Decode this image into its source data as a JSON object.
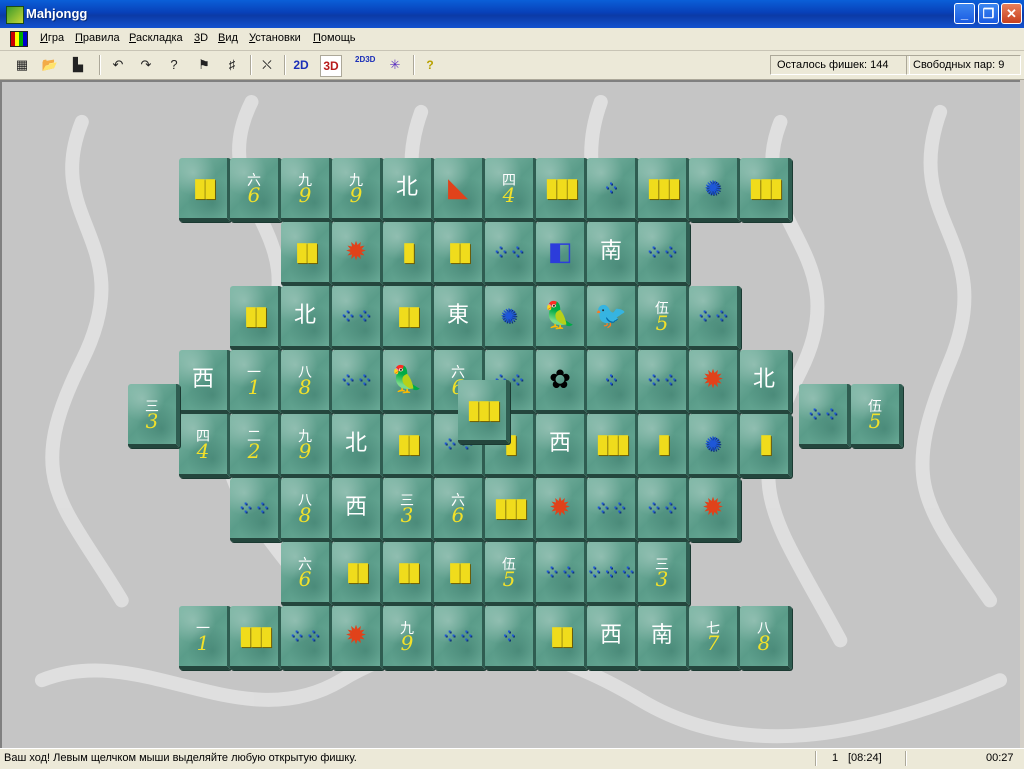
{
  "window": {
    "title": "Mahjongg"
  },
  "menu": [
    "Игра",
    "Правила",
    "Раскладка",
    "3D",
    "Вид",
    "Установки",
    "Помощь"
  ],
  "toolbar": {
    "buttons": [
      {
        "name": "new-game-icon",
        "glyph": "▦"
      },
      {
        "name": "open-game-icon",
        "glyph": "📂"
      },
      {
        "name": "scores-icon",
        "glyph": "▙"
      },
      {
        "name": "undo-icon",
        "glyph": "↶"
      },
      {
        "name": "redo-icon",
        "glyph": "↷"
      },
      {
        "name": "hint-icon",
        "glyph": "?"
      },
      {
        "name": "auto-play-icon",
        "glyph": "⚑"
      },
      {
        "name": "shuffle-icon",
        "glyph": "♯"
      },
      {
        "name": "exit-icon",
        "glyph": "⛌"
      }
    ],
    "view_2d": "2D",
    "view_3d": "3D",
    "toggle_2d3d": "2D3D",
    "help_icon": "?",
    "tiles_left": "Осталось фишек: 144",
    "free_pairs": "Свободных пар: 9"
  },
  "status": {
    "message": "Ваш ход!  Левым щелчком мыши выделяйте любую открытую фишку.",
    "game_number": "1",
    "game_time": "[08:24]",
    "elapsed": "00:27"
  },
  "tiles": [
    {
      "row": 0,
      "col": 0,
      "layer": 0,
      "kind": "bamboo",
      "face": "▮▮"
    },
    {
      "row": 0,
      "col": 1,
      "layer": 0,
      "kind": "char",
      "top": "六",
      "num": "6"
    },
    {
      "row": 0,
      "col": 2,
      "layer": 0,
      "kind": "char",
      "top": "九",
      "num": "9"
    },
    {
      "row": 0,
      "col": 3,
      "layer": 0,
      "kind": "char",
      "top": "九",
      "num": "9"
    },
    {
      "row": 0,
      "col": 4,
      "layer": 0,
      "kind": "wind",
      "face": "北"
    },
    {
      "row": 0,
      "col": 5,
      "layer": 0,
      "kind": "dragon",
      "face": "◣"
    },
    {
      "row": 0,
      "col": 6,
      "layer": 0,
      "kind": "char",
      "top": "四",
      "num": "4"
    },
    {
      "row": 0,
      "col": 7,
      "layer": 0,
      "kind": "bamboo",
      "face": "▮▮▮"
    },
    {
      "row": 0,
      "col": 8,
      "layer": 0,
      "kind": "circle",
      "face": "⁘"
    },
    {
      "row": 0,
      "col": 9,
      "layer": 0,
      "kind": "bamboo",
      "face": "▮▮▮"
    },
    {
      "row": 0,
      "col": 10,
      "layer": 0,
      "kind": "circle",
      "face": "✺"
    },
    {
      "row": 0,
      "col": 11,
      "layer": 0,
      "kind": "bamboo",
      "face": "▮▮▮"
    },
    {
      "row": 1,
      "col": 2,
      "layer": 0,
      "kind": "bamboo",
      "face": "▮▮"
    },
    {
      "row": 1,
      "col": 3,
      "layer": 0,
      "kind": "dragon",
      "face": "✹"
    },
    {
      "row": 1,
      "col": 4,
      "layer": 0,
      "kind": "bamboo",
      "face": "▮"
    },
    {
      "row": 1,
      "col": 5,
      "layer": 0,
      "kind": "bamboo",
      "face": "▮▮"
    },
    {
      "row": 1,
      "col": 6,
      "layer": 0,
      "kind": "circle",
      "face": "⁘⁘"
    },
    {
      "row": 1,
      "col": 7,
      "layer": 0,
      "kind": "season",
      "face": "◧"
    },
    {
      "row": 1,
      "col": 8,
      "layer": 0,
      "kind": "wind",
      "face": "南"
    },
    {
      "row": 1,
      "col": 9,
      "layer": 0,
      "kind": "circle",
      "face": "⁘⁘"
    },
    {
      "row": 2,
      "col": 1,
      "layer": 0,
      "kind": "bamboo",
      "face": "▮▮"
    },
    {
      "row": 2,
      "col": 2,
      "layer": 0,
      "kind": "wind",
      "face": "北"
    },
    {
      "row": 2,
      "col": 3,
      "layer": 0,
      "kind": "circle",
      "face": "⁘⁘"
    },
    {
      "row": 2,
      "col": 4,
      "layer": 0,
      "kind": "bamboo",
      "face": "▮▮"
    },
    {
      "row": 2,
      "col": 5,
      "layer": 0,
      "kind": "wind",
      "face": "東"
    },
    {
      "row": 2,
      "col": 6,
      "layer": 0,
      "kind": "circle",
      "face": "✺"
    },
    {
      "row": 2,
      "col": 7,
      "layer": 0,
      "kind": "flower",
      "face": "🦜"
    },
    {
      "row": 2,
      "col": 8,
      "layer": 0,
      "kind": "flower",
      "face": "🐦"
    },
    {
      "row": 2,
      "col": 9,
      "layer": 0,
      "kind": "char",
      "top": "伍",
      "num": "5"
    },
    {
      "row": 2,
      "col": 10,
      "layer": 0,
      "kind": "circle",
      "face": "⁘⁘"
    },
    {
      "row": 3,
      "col": 0,
      "layer": 0,
      "kind": "wind",
      "face": "西"
    },
    {
      "row": 3,
      "col": 1,
      "layer": 0,
      "kind": "char",
      "top": "一",
      "num": "1"
    },
    {
      "row": 3,
      "col": 2,
      "layer": 0,
      "kind": "char",
      "top": "八",
      "num": "8"
    },
    {
      "row": 3,
      "col": 3,
      "layer": 0,
      "kind": "circle",
      "face": "⁘⁘"
    },
    {
      "row": 3,
      "col": 4,
      "layer": 0,
      "kind": "flower",
      "face": "🦜"
    },
    {
      "row": 3,
      "col": 5,
      "layer": 0,
      "kind": "char",
      "top": "六",
      "num": "6"
    },
    {
      "row": 3,
      "col": 6,
      "layer": 0,
      "kind": "circle",
      "face": "⁘⁘"
    },
    {
      "row": 3,
      "col": 7,
      "layer": 0,
      "kind": "flower",
      "face": "✿"
    },
    {
      "row": 3,
      "col": 8,
      "layer": 0,
      "kind": "circle",
      "face": "⁘"
    },
    {
      "row": 3,
      "col": 9,
      "layer": 0,
      "kind": "circle",
      "face": "⁘⁘"
    },
    {
      "row": 3,
      "col": 10,
      "layer": 0,
      "kind": "dragon",
      "face": "✹"
    },
    {
      "row": 3,
      "col": 11,
      "layer": 0,
      "kind": "wind",
      "face": "北"
    },
    {
      "row": 4,
      "col": 0,
      "layer": 0,
      "kind": "char",
      "top": "四",
      "num": "4"
    },
    {
      "row": 4,
      "col": 1,
      "layer": 0,
      "kind": "char",
      "top": "二",
      "num": "2"
    },
    {
      "row": 4,
      "col": 2,
      "layer": 0,
      "kind": "char",
      "top": "九",
      "num": "9"
    },
    {
      "row": 4,
      "col": 3,
      "layer": 0,
      "kind": "wind",
      "face": "北"
    },
    {
      "row": 4,
      "col": 4,
      "layer": 0,
      "kind": "bamboo",
      "face": "▮▮"
    },
    {
      "row": 4,
      "col": 5,
      "layer": 0,
      "kind": "circle",
      "face": "⁘⁘"
    },
    {
      "row": 4,
      "col": 6,
      "layer": 0,
      "kind": "bamboo",
      "face": "▮"
    },
    {
      "row": 4,
      "col": 7,
      "layer": 0,
      "kind": "wind",
      "face": "西"
    },
    {
      "row": 4,
      "col": 8,
      "layer": 0,
      "kind": "bamboo",
      "face": "▮▮▮"
    },
    {
      "row": 4,
      "col": 9,
      "layer": 0,
      "kind": "bamboo",
      "face": "▮"
    },
    {
      "row": 4,
      "col": 10,
      "layer": 0,
      "kind": "circle",
      "face": "✺"
    },
    {
      "row": 4,
      "col": 11,
      "layer": 0,
      "kind": "bamboo",
      "face": "▮"
    },
    {
      "row": 5,
      "col": 1,
      "layer": 0,
      "kind": "circle",
      "face": "⁘⁘"
    },
    {
      "row": 5,
      "col": 2,
      "layer": 0,
      "kind": "char",
      "top": "八",
      "num": "8"
    },
    {
      "row": 5,
      "col": 3,
      "layer": 0,
      "kind": "wind",
      "face": "西"
    },
    {
      "row": 5,
      "col": 4,
      "layer": 0,
      "kind": "char",
      "top": "三",
      "num": "3"
    },
    {
      "row": 5,
      "col": 5,
      "layer": 0,
      "kind": "char",
      "top": "六",
      "num": "6"
    },
    {
      "row": 5,
      "col": 6,
      "layer": 0,
      "kind": "bamboo",
      "face": "▮▮▮"
    },
    {
      "row": 5,
      "col": 7,
      "layer": 0,
      "kind": "dragon",
      "face": "✹"
    },
    {
      "row": 5,
      "col": 8,
      "layer": 0,
      "kind": "circle",
      "face": "⁘⁘"
    },
    {
      "row": 5,
      "col": 9,
      "layer": 0,
      "kind": "circle",
      "face": "⁘⁘"
    },
    {
      "row": 5,
      "col": 10,
      "layer": 0,
      "kind": "dragon",
      "face": "✹"
    },
    {
      "row": 6,
      "col": 2,
      "layer": 0,
      "kind": "char",
      "top": "六",
      "num": "6"
    },
    {
      "row": 6,
      "col": 3,
      "layer": 0,
      "kind": "bamboo",
      "face": "▮▮"
    },
    {
      "row": 6,
      "col": 4,
      "layer": 0,
      "kind": "bamboo",
      "face": "▮▮"
    },
    {
      "row": 6,
      "col": 5,
      "layer": 0,
      "kind": "bamboo",
      "face": "▮▮"
    },
    {
      "row": 6,
      "col": 6,
      "layer": 0,
      "kind": "char",
      "top": "伍",
      "num": "5"
    },
    {
      "row": 6,
      "col": 7,
      "layer": 0,
      "kind": "circle",
      "face": "⁘⁘"
    },
    {
      "row": 6,
      "col": 8,
      "layer": 0,
      "kind": "circle",
      "face": "⁘⁘⁘"
    },
    {
      "row": 6,
      "col": 9,
      "layer": 0,
      "kind": "char",
      "top": "三",
      "num": "3"
    },
    {
      "row": 7,
      "col": 0,
      "layer": 0,
      "kind": "char",
      "top": "一",
      "num": "1"
    },
    {
      "row": 7,
      "col": 1,
      "layer": 0,
      "kind": "bamboo",
      "face": "▮▮▮"
    },
    {
      "row": 7,
      "col": 2,
      "layer": 0,
      "kind": "circle",
      "face": "⁘⁘"
    },
    {
      "row": 7,
      "col": 3,
      "layer": 0,
      "kind": "dragon",
      "face": "✹"
    },
    {
      "row": 7,
      "col": 4,
      "layer": 0,
      "kind": "char",
      "top": "九",
      "num": "9"
    },
    {
      "row": 7,
      "col": 5,
      "layer": 0,
      "kind": "circle",
      "face": "⁘⁘"
    },
    {
      "row": 7,
      "col": 6,
      "layer": 0,
      "kind": "circle",
      "face": "⁘"
    },
    {
      "row": 7,
      "col": 7,
      "layer": 0,
      "kind": "bamboo",
      "face": "▮▮"
    },
    {
      "row": 7,
      "col": 8,
      "layer": 0,
      "kind": "wind",
      "face": "西"
    },
    {
      "row": 7,
      "col": 9,
      "layer": 0,
      "kind": "wind",
      "face": "南"
    },
    {
      "row": 7,
      "col": 10,
      "layer": 0,
      "kind": "char",
      "top": "七",
      "num": "7"
    },
    {
      "row": 7,
      "col": 11,
      "layer": 0,
      "kind": "char",
      "top": "八",
      "num": "8"
    },
    {
      "row": 8,
      "col": -1,
      "layer": 0,
      "kind": "char",
      "top": "三",
      "num": "3"
    },
    {
      "row": 8,
      "col": 12,
      "layer": 0,
      "kind": "circle",
      "face": "⁘⁘"
    },
    {
      "row": 8,
      "col": 13,
      "layer": 0,
      "kind": "char",
      "top": "伍",
      "num": "5"
    },
    {
      "row": 9,
      "col": 5,
      "layer": 1,
      "kind": "bamboo",
      "face": "▮▮▮"
    }
  ]
}
